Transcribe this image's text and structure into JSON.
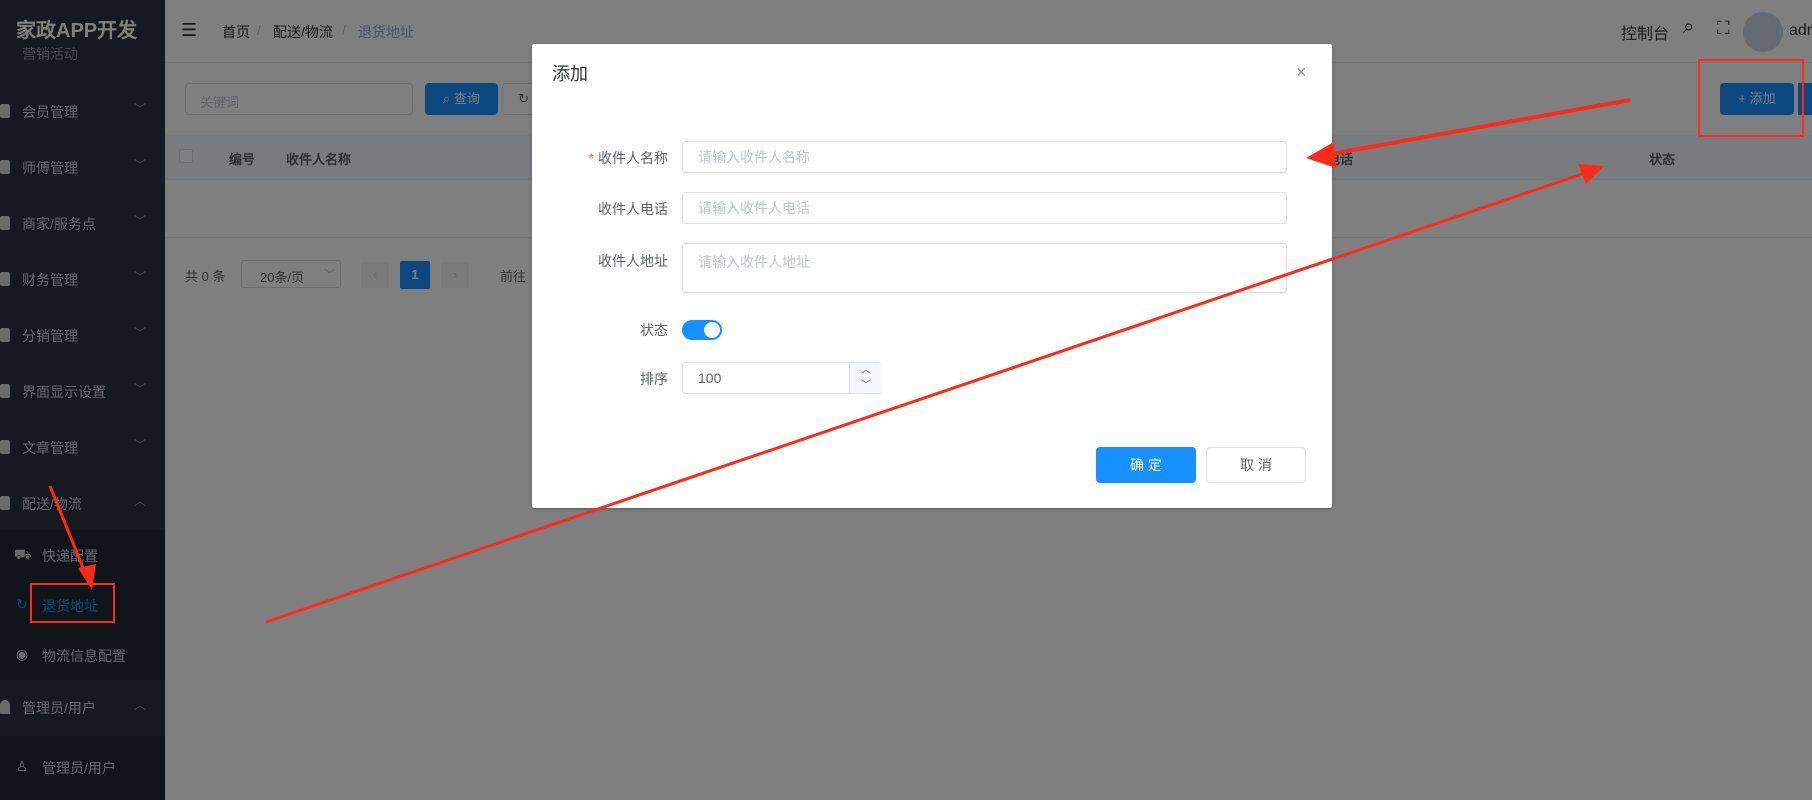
{
  "sidebar": {
    "logo": "家政APP开发",
    "top_partial": "营销活动",
    "items": [
      {
        "label": "会员管理",
        "icon": "user-icon"
      },
      {
        "label": "师傅管理",
        "icon": "target-icon"
      },
      {
        "label": "商家/服务点",
        "icon": "flag-icon"
      },
      {
        "label": "财务管理",
        "icon": "edit-icon"
      },
      {
        "label": "分销管理",
        "icon": "share-icon"
      },
      {
        "label": "界面显示设置",
        "icon": "phone-icon"
      },
      {
        "label": "文章管理",
        "icon": "doc-icon"
      },
      {
        "label": "配送/物流",
        "icon": "truck-icon"
      }
    ],
    "sub_items": [
      {
        "label": "快递配置",
        "icon": "truck-icon"
      },
      {
        "label": "退货地址",
        "icon": "refresh-icon"
      },
      {
        "label": "物流信息配置",
        "icon": "location-icon"
      }
    ],
    "admin_group": "管理员/用户",
    "admin_sub": "管理员/用户"
  },
  "header": {
    "breadcrumb": [
      "首页",
      "配送/物流",
      "退货地址"
    ],
    "separator": "/",
    "console": "控制台",
    "user": "admin"
  },
  "main": {
    "search_placeholder": "关键词",
    "query_button": "查询",
    "reset_button": "重置",
    "add_button": "+ 添加",
    "columns": [
      "编号",
      "收件人名称",
      "电话",
      "状态"
    ],
    "total": "共 0 条",
    "page_size": "20条/页",
    "page": "1",
    "goto": "前往"
  },
  "dialog": {
    "title": "添加",
    "fields": [
      {
        "label": "收件人名称",
        "placeholder": "请输入收件人名称",
        "required": "*"
      },
      {
        "label": "收件人电话",
        "placeholder": "请输入收件人电话"
      },
      {
        "label": "收件人地址",
        "placeholder": "请输入收件人地址"
      }
    ],
    "status_label": "状态",
    "status_on": true,
    "sort_label": "排序",
    "sort_value": "100",
    "confirm": "确 定",
    "cancel": "取 消"
  },
  "colors": {
    "primary": "#1890ff",
    "sidebar": "#2a3542",
    "annotation": "#ff2a1a"
  }
}
